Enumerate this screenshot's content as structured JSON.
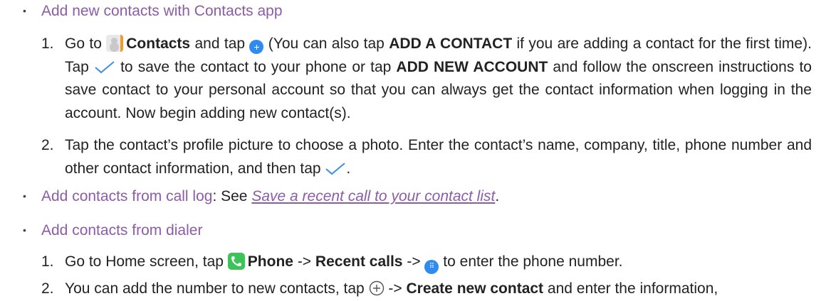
{
  "item1": {
    "heading": "Add new contacts with Contacts app",
    "steps": [
      {
        "num": "1.",
        "t1": "Go to",
        "b1": "Contacts",
        "t2": "and tap",
        "t3": "(You can also tap",
        "b2": "ADD A CONTACT",
        "t4": "if you are adding a contact for the first time). Tap",
        "t5": "to save the contact to your phone or tap",
        "b3": "ADD NEW ACCOUNT",
        "t6": "and follow the onscreen instructions to save contact to your personal account so that you can always get the contact information when logging in the account. Now begin adding new contact(s)."
      },
      {
        "num": "2.",
        "t1": "Tap the contact’s profile picture to choose a photo. Enter the contact’s name, company, title, phone number and other contact information, and then tap",
        "t2": "."
      }
    ]
  },
  "item2": {
    "heading": "Add contacts from call log",
    "sep": ": See",
    "link": "Save a recent call to your contact list",
    "end": "."
  },
  "item3": {
    "heading": "Add contacts from dialer",
    "steps": [
      {
        "num": "1.",
        "t1": "Go to Home screen, tap",
        "b1": "Phone",
        "t2": "->",
        "b2": "Recent calls",
        "t3": "->",
        "t4": "to enter the phone number."
      },
      {
        "num": "2.",
        "t1": "You can add the number to new contacts, tap",
        "t2": "->",
        "b1": "Create new contact",
        "t3": "and enter the information,"
      }
    ]
  },
  "icons": {
    "contacts": "contacts-app-icon",
    "add": "add-plus-icon",
    "check": "checkmark-icon",
    "phone": "phone-app-icon",
    "dialpad": "dialpad-icon",
    "add_outline": "plus-circle-icon"
  },
  "colors": {
    "accent": "#8d5ca8",
    "blue": "#2f8bf0",
    "check": "#3a8fe6",
    "phone": "#3cc45a"
  }
}
